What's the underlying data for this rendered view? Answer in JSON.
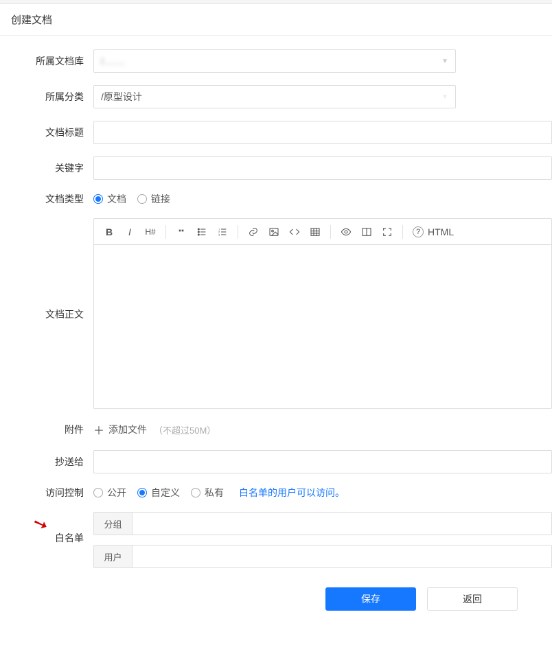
{
  "page": {
    "title": "创建文档"
  },
  "labels": {
    "library": "所属文档库",
    "category": "所属分类",
    "docTitle": "文档标题",
    "keywords": "关键字",
    "docType": "文档类型",
    "body": "文档正文",
    "attachment": "附件",
    "cc": "抄送给",
    "access": "访问控制",
    "whitelist": "白名单"
  },
  "library": {
    "value": "/........"
  },
  "category": {
    "value": "/原型设计"
  },
  "docTitle": {
    "value": ""
  },
  "keywords": {
    "value": ""
  },
  "docType": {
    "options": [
      {
        "label": "文档",
        "checked": true
      },
      {
        "label": "链接",
        "checked": false
      }
    ]
  },
  "editor": {
    "htmlMode": "HTML"
  },
  "attachment": {
    "addLabel": "添加文件",
    "hint": "（不超过50M）"
  },
  "cc": {
    "value": ""
  },
  "access": {
    "options": [
      {
        "label": "公开",
        "checked": false
      },
      {
        "label": "自定义",
        "checked": true
      },
      {
        "label": "私有",
        "checked": false
      }
    ],
    "hint": "白名单的用户可以访问。"
  },
  "whitelist": {
    "group": {
      "label": "分组",
      "value": ""
    },
    "user": {
      "label": "用户",
      "value": ""
    }
  },
  "actions": {
    "save": "保存",
    "back": "返回"
  }
}
